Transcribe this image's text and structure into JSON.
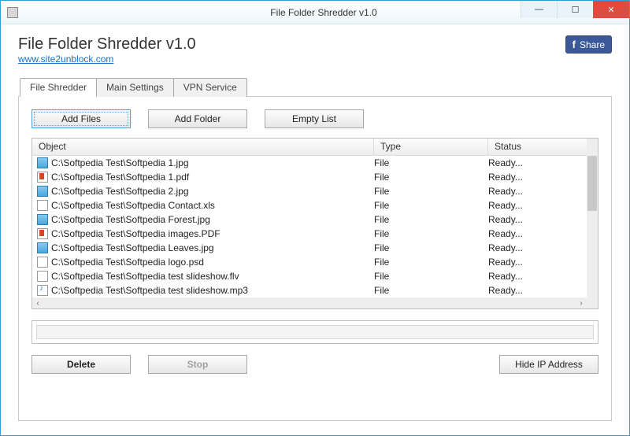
{
  "window": {
    "title": "File Folder Shredder v1.0"
  },
  "header": {
    "app_title": "File Folder Shredder v1.0",
    "link": "www.site2unblock.com",
    "share_label": "Share"
  },
  "tabs": [
    {
      "label": "File Shredder",
      "active": true
    },
    {
      "label": "Main Settings",
      "active": false
    },
    {
      "label": "VPN Service",
      "active": false
    }
  ],
  "buttons": {
    "add_files": "Add Files",
    "add_folder": "Add Folder",
    "empty_list": "Empty List",
    "delete": "Delete",
    "stop": "Stop",
    "hide_ip": "Hide IP Address"
  },
  "columns": {
    "object": "Object",
    "type": "Type",
    "status": "Status"
  },
  "rows": [
    {
      "icon": "image",
      "path": "C:\\Softpedia Test\\Softpedia 1.jpg",
      "type": "File",
      "status": "Ready..."
    },
    {
      "icon": "pdf",
      "path": "C:\\Softpedia Test\\Softpedia 1.pdf",
      "type": "File",
      "status": "Ready..."
    },
    {
      "icon": "image",
      "path": "C:\\Softpedia Test\\Softpedia 2.jpg",
      "type": "File",
      "status": "Ready..."
    },
    {
      "icon": "file",
      "path": "C:\\Softpedia Test\\Softpedia Contact.xls",
      "type": "File",
      "status": "Ready..."
    },
    {
      "icon": "image",
      "path": "C:\\Softpedia Test\\Softpedia Forest.jpg",
      "type": "File",
      "status": "Ready..."
    },
    {
      "icon": "pdf",
      "path": "C:\\Softpedia Test\\Softpedia images.PDF",
      "type": "File",
      "status": "Ready..."
    },
    {
      "icon": "image",
      "path": "C:\\Softpedia Test\\Softpedia Leaves.jpg",
      "type": "File",
      "status": "Ready..."
    },
    {
      "icon": "file",
      "path": "C:\\Softpedia Test\\Softpedia logo.psd",
      "type": "File",
      "status": "Ready..."
    },
    {
      "icon": "file",
      "path": "C:\\Softpedia Test\\Softpedia test slideshow.flv",
      "type": "File",
      "status": "Ready..."
    },
    {
      "icon": "audio",
      "path": "C:\\Softpedia Test\\Softpedia test slideshow.mp3",
      "type": "File",
      "status": "Ready..."
    }
  ]
}
